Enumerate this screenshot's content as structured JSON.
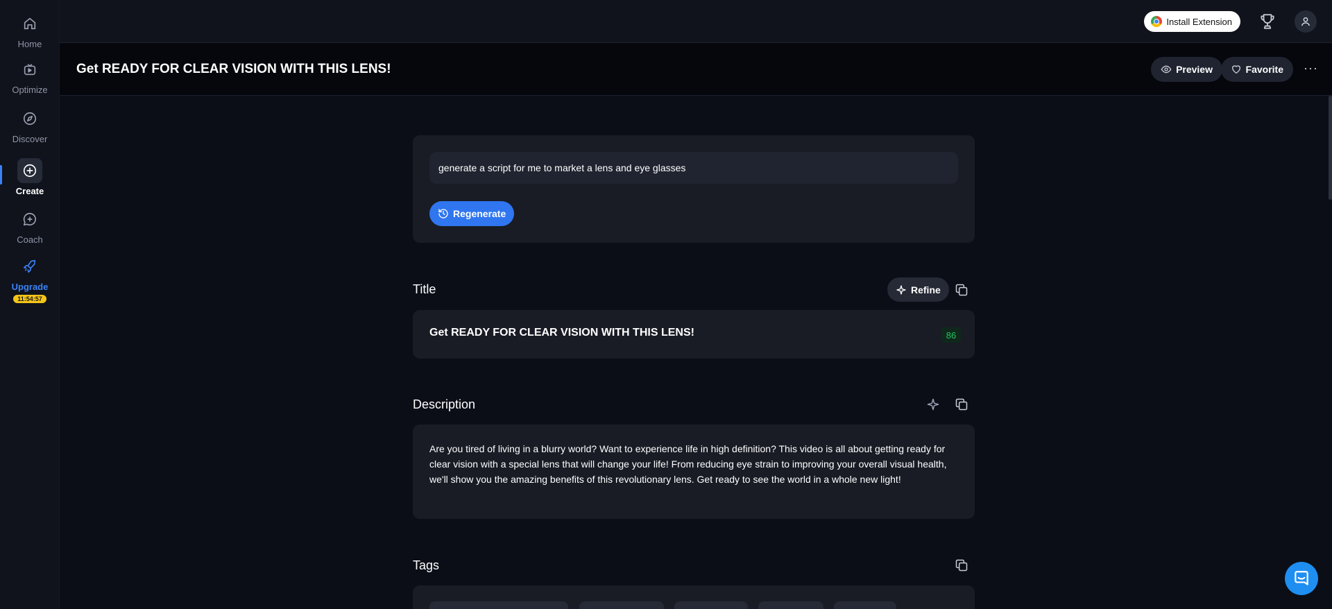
{
  "sidebar": {
    "items": [
      {
        "label": "Home",
        "icon": "home-icon"
      },
      {
        "label": "Optimize",
        "icon": "optimize-icon"
      },
      {
        "label": "Discover",
        "icon": "compass-icon"
      },
      {
        "label": "Create",
        "icon": "plus-circle-icon",
        "active": true
      },
      {
        "label": "Coach",
        "icon": "chat-plus-icon"
      },
      {
        "label": "Upgrade",
        "icon": "rocket-icon"
      }
    ],
    "timer": "11:54:57"
  },
  "topbar": {
    "install_label": "Install Extension"
  },
  "header": {
    "title": "Get READY FOR CLEAR VISION WITH THIS LENS!",
    "preview_label": "Preview",
    "favorite_label": "Favorite",
    "more_label": "···"
  },
  "prompt": {
    "value": "generate a script for me to market a lens and eye glasses",
    "regenerate_label": "Regenerate"
  },
  "title_section": {
    "label": "Title",
    "refine_label": "Refine",
    "text": "Get READY FOR CLEAR VISION WITH THIS LENS!",
    "score": "86"
  },
  "description_section": {
    "label": "Description",
    "text": "Are you tired of living in a blurry world? Want to experience life in high definition? This video is all about getting ready for clear vision with a special lens that will change your life! From reducing eye strain to improving your overall visual health, we'll show you the amazing benefits of this revolutionary lens. Get ready to see the world in a whole new light!"
  },
  "tags_section": {
    "label": "Tags"
  },
  "colors": {
    "accent": "#2f76f0",
    "score_green": "#22c55e",
    "timer_yellow": "#f5c518"
  }
}
